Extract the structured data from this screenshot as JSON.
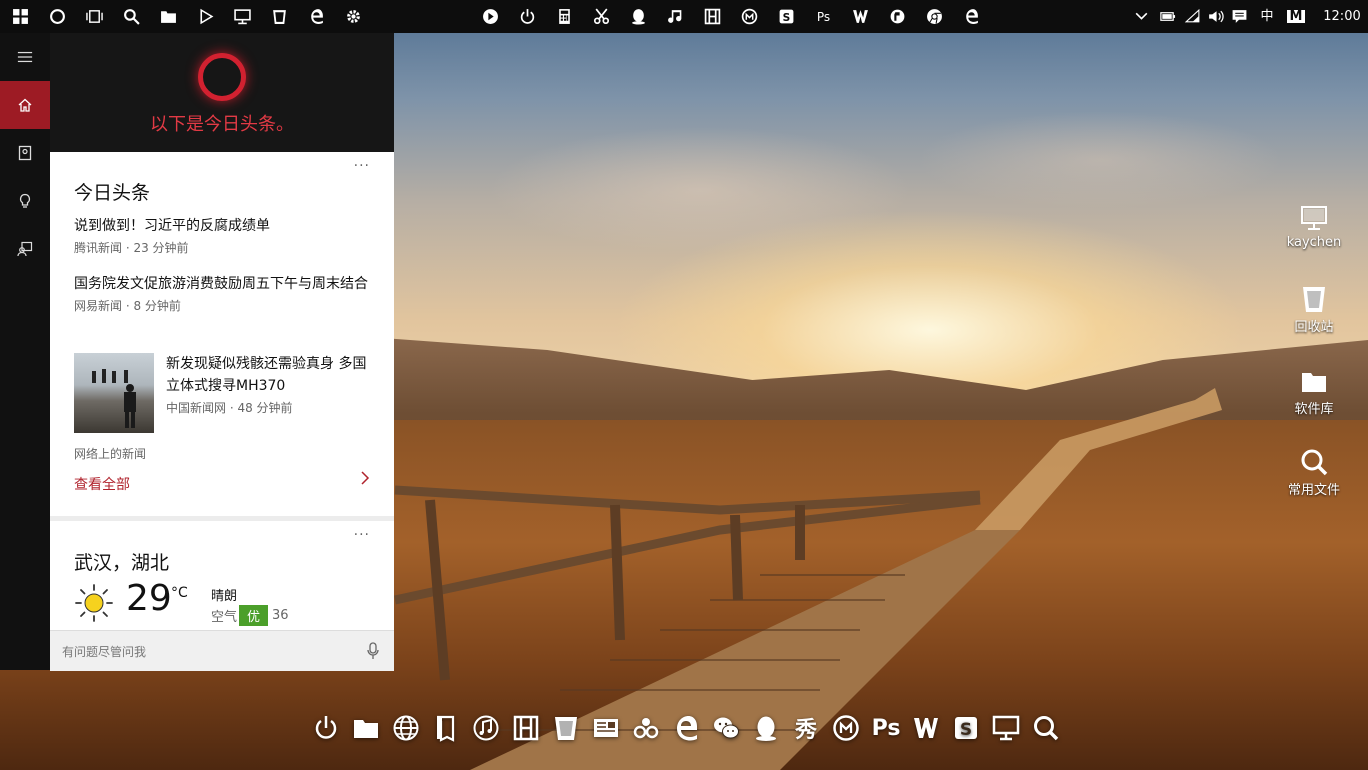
{
  "taskbar": {
    "left_icons": [
      "windows-icon",
      "cortana-circle-icon",
      "task-view-icon",
      "search-icon",
      "folder-icon",
      "play-icon",
      "monitor-icon",
      "recycle-bin-icon",
      "edge-icon",
      "gear-icon"
    ],
    "center_icons": [
      "media-player-icon",
      "power-icon",
      "calculator-icon",
      "scissors-icon",
      "qq-icon",
      "music-icon",
      "film-icon",
      "mx-icon",
      "s-app-icon",
      "ps-app-icon",
      "w-app-icon",
      "app-icon",
      "chrome-icon",
      "edge-icon"
    ],
    "center_ps_label": "Ps",
    "tray": {
      "ime_label": "中",
      "m_label": "M",
      "clock": "12:00"
    }
  },
  "cortana": {
    "greeting": "以下是今日头条。",
    "news": {
      "more": "···",
      "title": "今日头条",
      "items": [
        {
          "headline": "说到做到！习近平的反腐成绩单",
          "meta": "腾讯新闻 · 23 分钟前"
        },
        {
          "headline": "国务院发文促旅游消费鼓励周五下午与周末结合",
          "meta": "网易新闻 · 8 分钟前"
        },
        {
          "headline": "新发现疑似残骸还需验真身 多国立体式搜寻MH370",
          "meta": "中国新闻网 · 48 分钟前"
        }
      ],
      "source_label": "网络上的新闻",
      "see_all": "查看全部"
    },
    "weather": {
      "more": "···",
      "city": "武汉，湖北",
      "temp": "29",
      "unit": "°C",
      "condition": "晴朗",
      "aqi_label": "空气",
      "aqi_badge": "优",
      "aqi_value": "36"
    },
    "search_placeholder": "有问题尽管问我"
  },
  "desktop_icons": [
    {
      "label": "kaychen",
      "icon": "computer-icon"
    },
    {
      "label": "回收站",
      "icon": "recycle-bin-icon"
    },
    {
      "label": "软件库",
      "icon": "folder-icon"
    },
    {
      "label": "常用文件",
      "icon": "search-icon"
    }
  ],
  "dock": {
    "icons": [
      "power-icon",
      "folder-icon",
      "globe-icon",
      "book-icon",
      "music-icon",
      "film-icon",
      "recycle-bin-icon",
      "news-icon",
      "app-icon",
      "edge-icon",
      "wechat-icon",
      "qq-icon",
      "xiu-app-icon",
      "mx-icon",
      "ps-app-icon",
      "w-app-icon",
      "s-app-icon",
      "monitor-icon",
      "search-icon"
    ],
    "xiu_label": "秀",
    "ps_label": "Ps"
  },
  "colors": {
    "accent": "#9d1b24",
    "cortana_ring": "#d22130",
    "link": "#b0232d",
    "aqi_good": "#4b9f2a"
  }
}
